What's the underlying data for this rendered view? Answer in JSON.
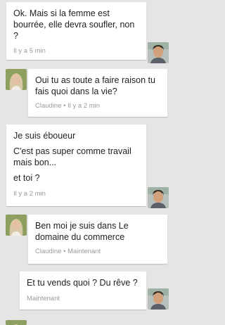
{
  "messages": [
    {
      "sender": "me",
      "paragraphs": [
        "Ok. Mais si la femme est bourrée, elle devra soufler, non ?"
      ],
      "meta": "Il y a 5 min"
    },
    {
      "sender": "Claudine",
      "paragraphs": [
        "Oui tu as toute a faire raison tu fais quoi dans la vie?"
      ],
      "meta": "Claudine • Il y a 2 min"
    },
    {
      "sender": "me",
      "paragraphs": [
        "Je suis éboueur",
        "C'est pas super comme travail mais bon...",
        "et toi ?"
      ],
      "meta": "Il y a 2 min"
    },
    {
      "sender": "Claudine",
      "paragraphs": [
        "Ben moi je suis dans Le domaine du commerce"
      ],
      "meta": "Claudine • Maintenant"
    },
    {
      "sender": "me",
      "paragraphs": [
        "Et tu vends quoi ? Du rêve ?"
      ],
      "meta": "Maintenant"
    }
  ]
}
